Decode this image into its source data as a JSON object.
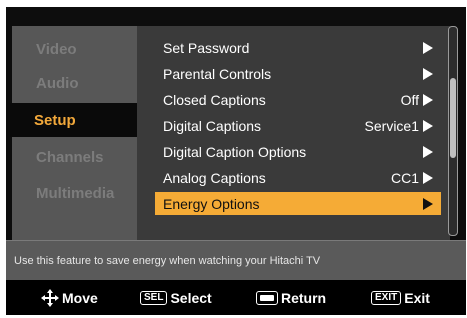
{
  "nav": {
    "items": [
      {
        "label": "Video",
        "active": false
      },
      {
        "label": "Audio",
        "active": false
      },
      {
        "label": "Setup",
        "active": true
      },
      {
        "label": "Channels",
        "active": false
      },
      {
        "label": "Multimedia",
        "active": false
      }
    ]
  },
  "setup_menu": {
    "options": [
      {
        "label": "Set Password",
        "value": ""
      },
      {
        "label": "Parental Controls",
        "value": ""
      },
      {
        "label": "Closed Captions",
        "value": "Off"
      },
      {
        "label": "Digital Captions",
        "value": "Service1"
      },
      {
        "label": "Digital Caption Options",
        "value": ""
      },
      {
        "label": "Analog Captions",
        "value": "CC1"
      },
      {
        "label": "Energy Options",
        "value": "",
        "selected": true
      }
    ],
    "scroll_position": 0.4
  },
  "info": {
    "text": "Use this feature to save energy when watching your Hitachi TV"
  },
  "controls": {
    "move_label": "Move",
    "select_key": "SEL",
    "select_label": "Select",
    "return_label": "Return",
    "exit_key": "EXIT",
    "exit_label": "Exit"
  },
  "colors": {
    "highlight": "#f5ab36",
    "active_nav_text": "#f3a93b"
  }
}
